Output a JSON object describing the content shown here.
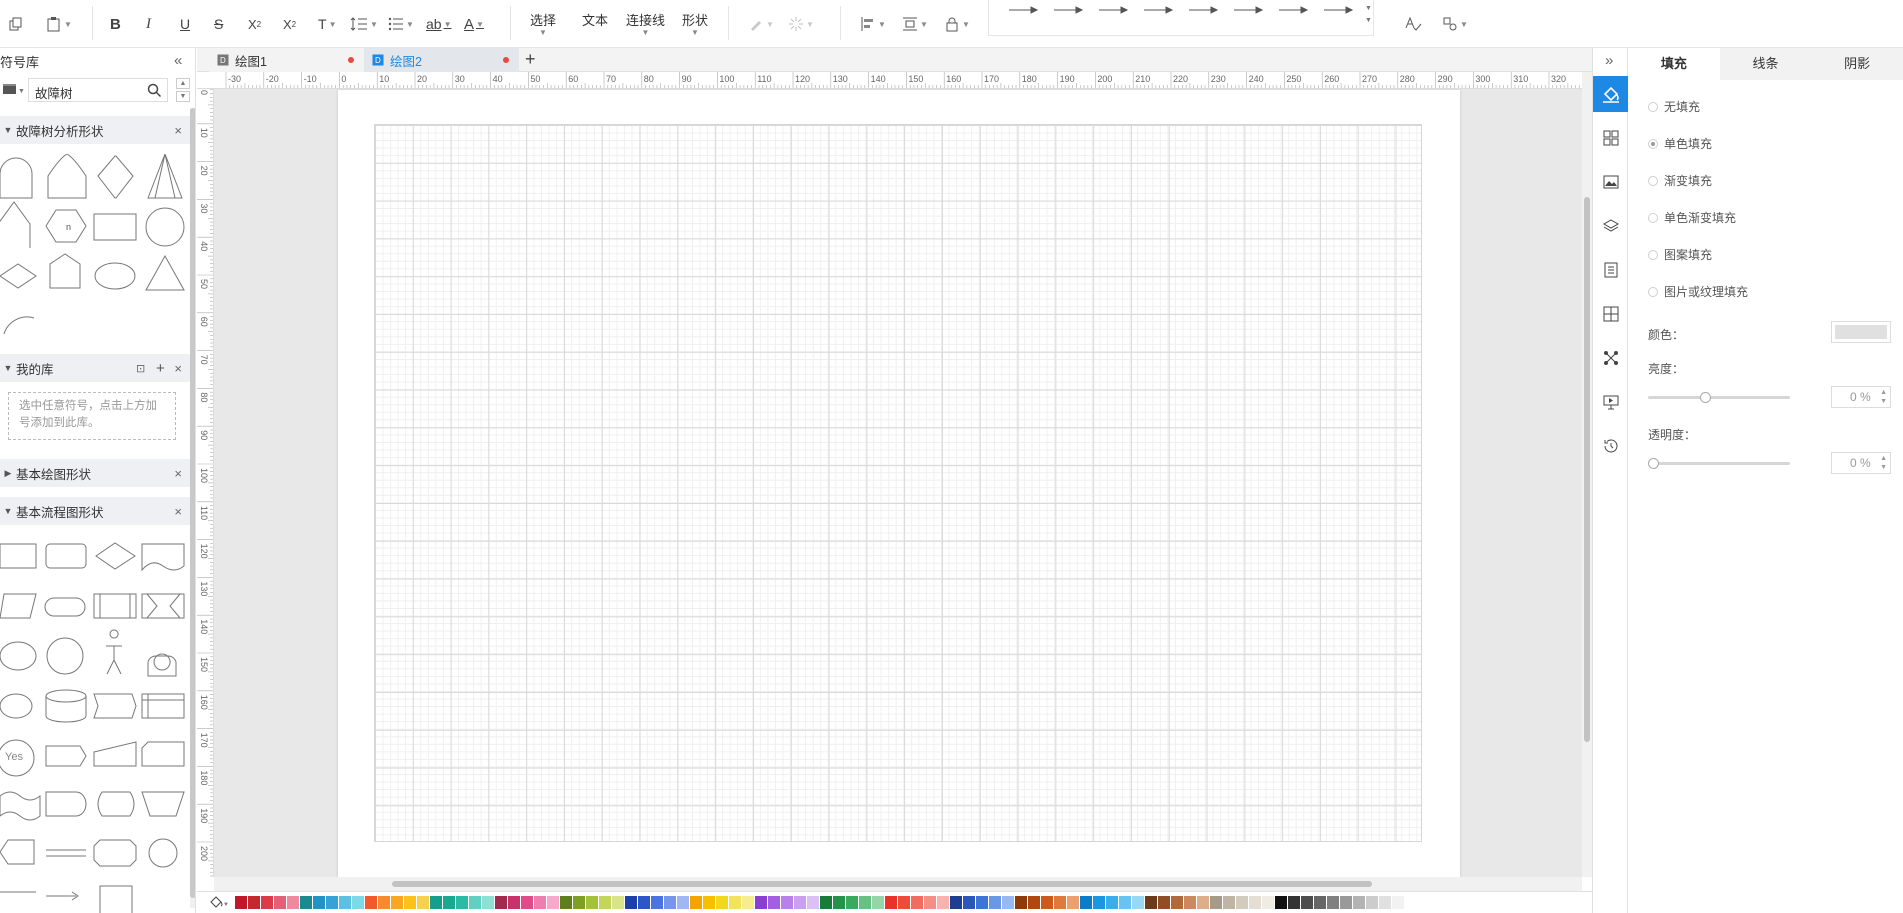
{
  "toolbar": {
    "tabs": {
      "select": "选择",
      "text": "文本",
      "connector": "连接线",
      "shape": "形状"
    }
  },
  "left_panel": {
    "title": "符号库",
    "search_value": "故障树",
    "sections": {
      "fault_tree": "故障树分析形状",
      "my_library": "我的库",
      "my_library_hint": "选中任意符号，点击上方加号添加到此库。",
      "basic_drawing": "基本绘图形状",
      "basic_flowchart": "基本流程图形状"
    },
    "n_label": "n",
    "yes_label": "Yes"
  },
  "doc_tabs": [
    {
      "label": "绘图1"
    },
    {
      "label": "绘图2"
    }
  ],
  "ruler": {
    "top_labels": [
      "-30",
      "-20",
      "-10",
      "0",
      "10",
      "20",
      "30",
      "40",
      "50",
      "60",
      "70",
      "80",
      "90",
      "100",
      "110",
      "120",
      "130",
      "140",
      "150",
      "160",
      "170",
      "180",
      "190",
      "200",
      "210",
      "220",
      "230",
      "240",
      "250",
      "260",
      "270",
      "280",
      "290",
      "300",
      "310",
      "320"
    ],
    "left_labels": [
      "0",
      "10",
      "20",
      "30",
      "40",
      "50",
      "60",
      "70",
      "80",
      "90",
      "100",
      "110",
      "120",
      "130",
      "140",
      "150",
      "160",
      "170",
      "180",
      "190",
      "200"
    ]
  },
  "props": {
    "tabs": [
      "填充",
      "线条",
      "阴影"
    ],
    "fill_options": [
      "无填充",
      "单色填充",
      "渐变填充",
      "单色渐变填充",
      "图案填充",
      "图片或纹理填充"
    ],
    "selected_option_index": 1,
    "color_label": "颜色：",
    "brightness_label": "亮度：",
    "brightness_value": "0 %",
    "brightness_level": 0.4,
    "transparency_label": "透明度：",
    "transparency_value": "0 %",
    "transparency_level": 0
  },
  "palette_colors": [
    "#c0172b",
    "#c5282f",
    "#dc3a4b",
    "#e46076",
    "#ee8aa0",
    "#1a8a8f",
    "#2193c4",
    "#36a2d6",
    "#5cc0e0",
    "#7dd8e8",
    "#f25a2d",
    "#f78a2d",
    "#f9a623",
    "#fbc21d",
    "#f6d04e",
    "#159e8a",
    "#1aa88e",
    "#2bbba5",
    "#62cfc1",
    "#8ee0d5",
    "#a22a4d",
    "#c8316a",
    "#e04c8a",
    "#ee7eb0",
    "#f5aacb",
    "#5f7f1e",
    "#7e9f24",
    "#a4c13a",
    "#c4d65a",
    "#d8e38a",
    "#1c3fa8",
    "#2d56c8",
    "#4b74e0",
    "#7596ea",
    "#a0b7f2",
    "#f4a300",
    "#f6c000",
    "#f0d81c",
    "#f2e45a",
    "#f6ed92",
    "#8a3fd1",
    "#a35fe0",
    "#b980ea",
    "#cba0f0",
    "#dcc0f5",
    "#1a7a3a",
    "#25924a",
    "#39a95e",
    "#68c083",
    "#96d5a8",
    "#e8332a",
    "#ee4b3c",
    "#f26b5e",
    "#f58f85",
    "#f8b3ac",
    "#1f3e8f",
    "#2b57b8",
    "#3f74d6",
    "#6a97e6",
    "#97b8f0",
    "#8c3a0a",
    "#b04710",
    "#cc5a1d",
    "#e07a3c",
    "#eca06e",
    "#0b7dc8",
    "#1b96e0",
    "#3aaeea",
    "#67c3f0",
    "#98d8f5",
    "#6a3a1a",
    "#8f4e25",
    "#b0693a",
    "#c98a5e",
    "#dcae8a",
    "#a89a88",
    "#c0b4a4",
    "#d4cbbf",
    "#e4ded4",
    "#f0ece4",
    "#111111",
    "#333333",
    "#4d4d4d",
    "#666666",
    "#808080",
    "#999999",
    "#b3b3b3",
    "#cccccc",
    "#e0e0e0",
    "#f2f2f2"
  ]
}
